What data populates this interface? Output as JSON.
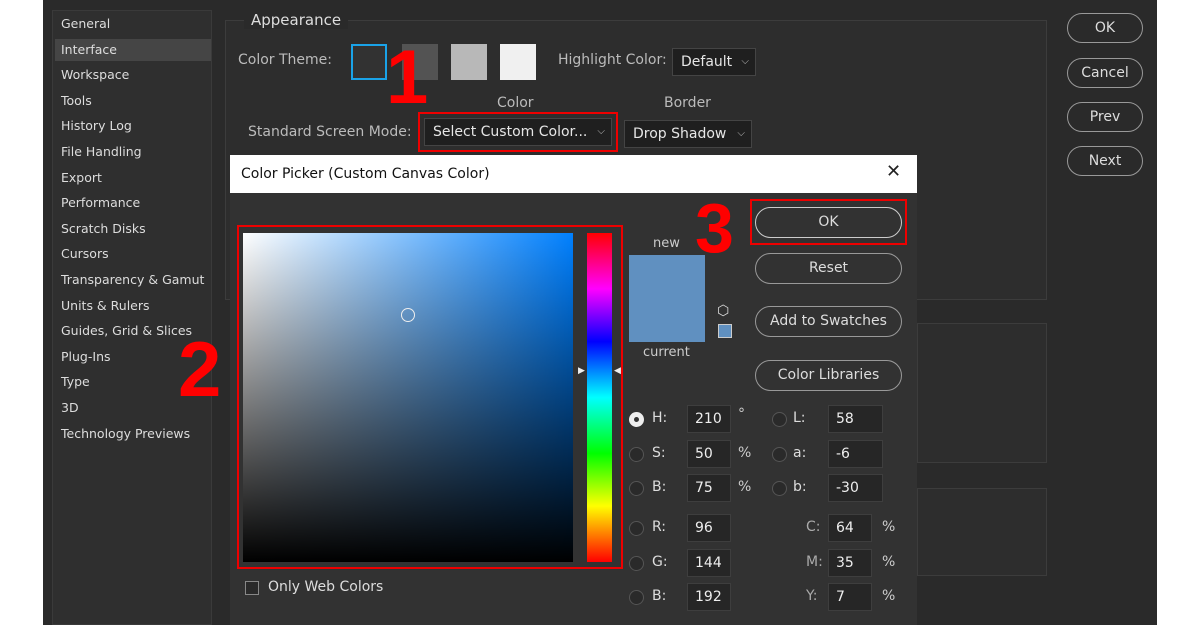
{
  "sidebar": {
    "items": [
      "General",
      "Interface",
      "Workspace",
      "Tools",
      "History Log",
      "File Handling",
      "Export",
      "Performance",
      "Scratch Disks",
      "Cursors",
      "Transparency & Gamut",
      "Units & Rulers",
      "Guides, Grid & Slices",
      "Plug-Ins",
      "Type",
      "3D",
      "Technology Previews"
    ],
    "selected": "Interface"
  },
  "appearance": {
    "title": "Appearance",
    "color_theme_label": "Color Theme:",
    "highlight_label": "Highlight Color:",
    "highlight_value": "Default",
    "color_header": "Color",
    "border_header": "Border",
    "screen_mode_label": "Standard Screen Mode:",
    "screen_mode_color": "Select Custom Color...",
    "screen_mode_border": "Drop Shadow",
    "theme_colors": [
      "#323232",
      "#535353",
      "#b8b8b8",
      "#f0f0f0"
    ]
  },
  "right_buttons": {
    "ok": "OK",
    "cancel": "Cancel",
    "prev": "Prev",
    "next": "Next"
  },
  "annotations": {
    "step1": "1",
    "step2": "2",
    "step3": "3",
    "color": "#e00000"
  },
  "picker": {
    "title": "Color Picker (Custom Canvas Color)",
    "close": "✕",
    "new_label": "new",
    "current_label": "current",
    "new_color": "#6090c0",
    "current_color": "#6090c0",
    "buttons": {
      "ok": "OK",
      "reset": "Reset",
      "add": "Add to Swatches",
      "libraries": "Color Libraries"
    },
    "only_web_colors": "Only Web Colors",
    "hsb": [
      {
        "label": "H:",
        "value": "210",
        "unit": "°",
        "selected": true
      },
      {
        "label": "S:",
        "value": "50",
        "unit": "%"
      },
      {
        "label": "B:",
        "value": "75",
        "unit": "%"
      }
    ],
    "lab": [
      {
        "label": "L:",
        "value": "58"
      },
      {
        "label": "a:",
        "value": "-6"
      },
      {
        "label": "b:",
        "value": "-30"
      }
    ],
    "rgb": [
      {
        "label": "R:",
        "value": "96"
      },
      {
        "label": "G:",
        "value": "144"
      },
      {
        "label": "B:",
        "value": "192"
      }
    ],
    "cmyk": [
      {
        "label": "C:",
        "value": "64",
        "unit": "%"
      },
      {
        "label": "M:",
        "value": "35",
        "unit": "%"
      },
      {
        "label": "Y:",
        "value": "7",
        "unit": "%"
      }
    ],
    "hue_color": "#0080ff"
  }
}
